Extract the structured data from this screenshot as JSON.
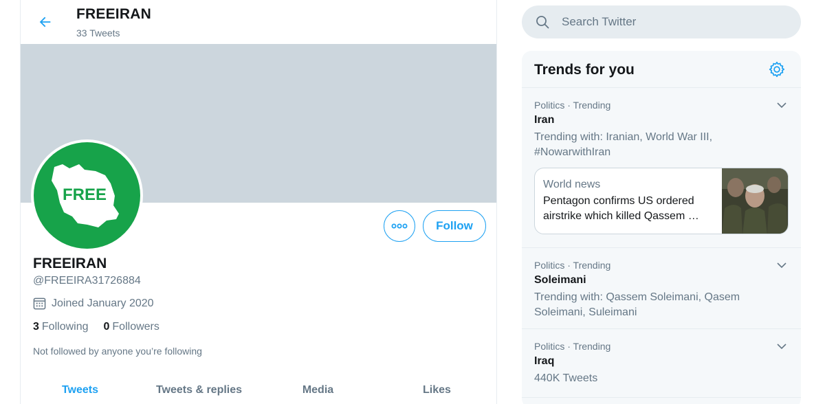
{
  "header": {
    "title": "FREEIRAN",
    "tweet_count": "33 Tweets"
  },
  "profile": {
    "avatar_text": "FREE",
    "name": "FREEIRAN",
    "handle": "@FREEIRA31726884",
    "joined": "Joined January 2020",
    "following_count": "3",
    "following_label": "Following",
    "followers_count": "0",
    "followers_label": "Followers",
    "not_followed": "Not followed by anyone you’re following",
    "follow_label": "Follow"
  },
  "tabs": [
    {
      "label": "Tweets",
      "active": true
    },
    {
      "label": "Tweets & replies",
      "active": false
    },
    {
      "label": "Media",
      "active": false
    },
    {
      "label": "Likes",
      "active": false
    }
  ],
  "search": {
    "placeholder": "Search Twitter"
  },
  "trends": {
    "title": "Trends for you",
    "items": [
      {
        "meta": "Politics · Trending",
        "name": "Iran",
        "with": "Trending with: Iranian, World War III, #NowarwithIran",
        "news": {
          "source": "World news",
          "headline": "Pentagon confirms US ordered airstrike which killed Qassem …"
        }
      },
      {
        "meta": "Politics · Trending",
        "name": "Soleimani",
        "with": "Trending with: Qassem Soleimani, Qasem Soleimani, Suleimani"
      },
      {
        "meta": "Politics · Trending",
        "name": "Iraq",
        "with": "440K Tweets"
      }
    ]
  },
  "colors": {
    "accent": "#1da1f2",
    "banner": "#ccd6dd",
    "avatar_green": "#17a34a",
    "muted_text": "#657786"
  },
  "icons": {
    "back": "arrow-left-icon",
    "more": "more-horizontal-icon",
    "calendar": "calendar-icon",
    "search": "search-icon",
    "settings": "gear-icon",
    "chevron": "chevron-down-icon"
  }
}
